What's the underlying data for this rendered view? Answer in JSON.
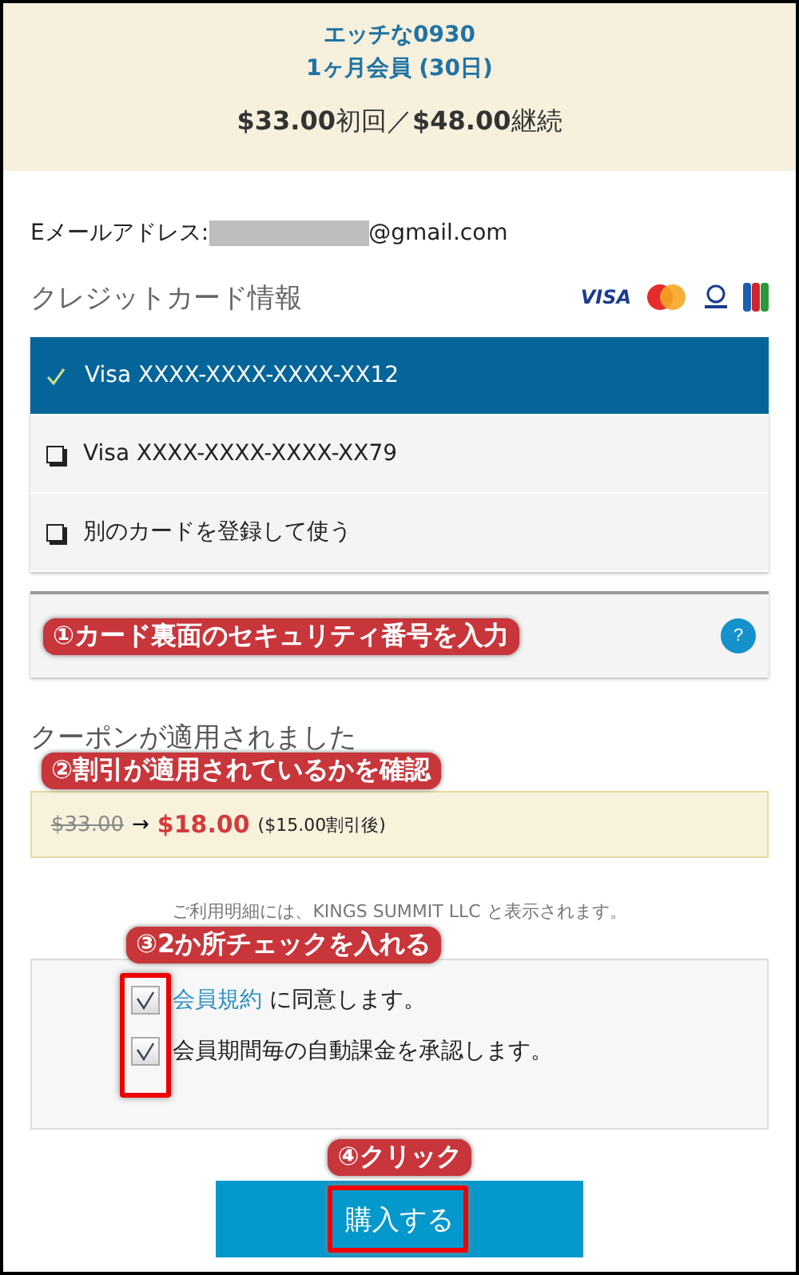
{
  "header": {
    "title_lines": [
      "エッチな0930",
      "1ヶ月会員 (30日)"
    ],
    "price_first": "$33.00",
    "price_first_label": "初回",
    "separator": "／",
    "price_renew": "$48.00",
    "price_renew_label": "継続"
  },
  "email": {
    "label": "Eメールアドレス:",
    "value": "@gmail.com"
  },
  "card_section": {
    "title": "クレジットカード情報",
    "brand_label": "VISA"
  },
  "cards": [
    {
      "label": "Visa XXXX-XXXX-XXXX-XX12",
      "selected": true
    },
    {
      "label": "Visa XXXX-XXXX-XXXX-XX79",
      "selected": false
    },
    {
      "label": "別のカードを登録して使う",
      "selected": false
    }
  ],
  "security_field": {
    "annotation": "①カード裏面のセキュリティ番号を入力",
    "help": "?"
  },
  "coupon": {
    "title": "クーポンが適用されました",
    "annotation": "②割引が適用されているかを確認",
    "old_price": "$33.00",
    "arrow": "→",
    "new_price": "$18.00",
    "discount": "($15.00割引後)"
  },
  "statement_note": "ご利用明細には、KINGS SUMMIT LLC と表示されます。",
  "agreements": {
    "annotation": "③2か所チェックを入れる",
    "items": [
      {
        "link": "会員規約",
        "text": " に同意します。",
        "checked": true
      },
      {
        "text": "会員期間毎の自動課金を承認します。",
        "checked": true
      }
    ]
  },
  "purchase": {
    "annotation": "④クリック",
    "button": "購入する"
  }
}
